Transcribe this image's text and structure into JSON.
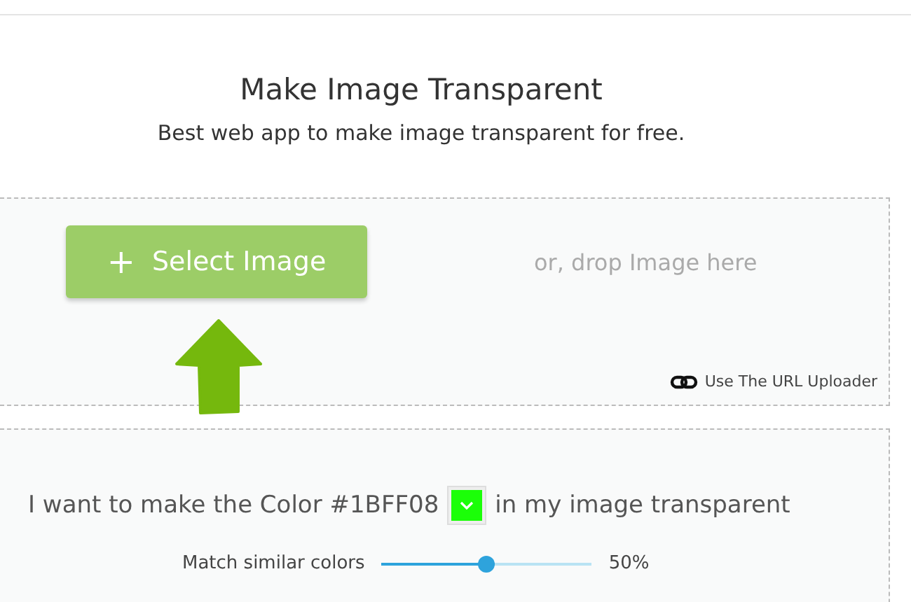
{
  "title": "Make Image Transparent",
  "subtitle": "Best web app to make image transparent for free.",
  "upload": {
    "button": "Select Image",
    "button_icon": "+",
    "drop_hint": "or, drop Image here",
    "url_link": "Use The URL Uploader"
  },
  "options": {
    "sentence_before": "I want to make the Color #1BFF08",
    "swatch": {
      "color": "#1bff08"
    },
    "sentence_after": "in my image transparent",
    "slider": {
      "label": "Match similar colors",
      "level": 0.5,
      "reading": "50%"
    }
  }
}
